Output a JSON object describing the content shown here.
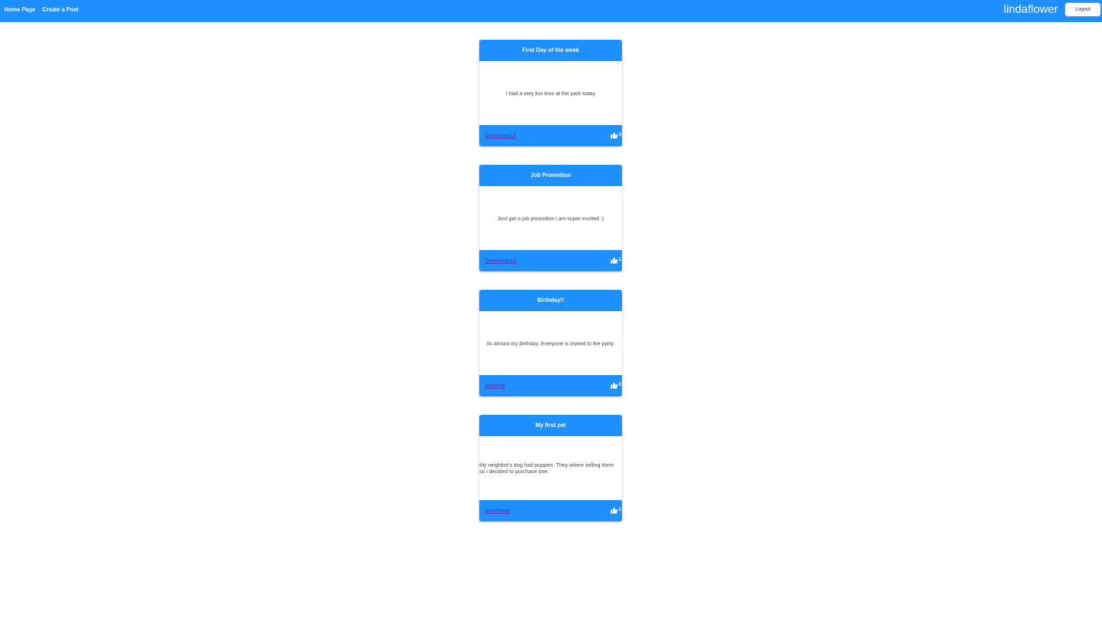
{
  "nav": {
    "home_label": "Home Page",
    "create_label": "Create a Post",
    "username": "lindaflower",
    "logout_label": "Logout"
  },
  "colors": {
    "accent": "#1e90ff",
    "author_link": "#5a2ea6"
  },
  "posts": [
    {
      "title": "First Day of the week",
      "body": "I had a very fun time at the park today",
      "author": "Greenman12",
      "likes": "3",
      "like_icon": "thumbs-up-icon"
    },
    {
      "title": "Job Promotion",
      "body": "Just got a job promotion i am super excited :)",
      "author": "Greenman12",
      "likes": "1",
      "like_icon": "thumbs-up-icon"
    },
    {
      "title": "Birthday!!",
      "body": "Its almost my birthday. Everyone is invited to the party.",
      "author": "tommyG",
      "likes": "0",
      "like_icon": "thumbs-up-icon"
    },
    {
      "title": "My first pet",
      "body": "My neighbor's dog had puppies. They where selling them so i decided to purchase one.",
      "author": "lindaflower",
      "likes": "1",
      "like_icon": "thumbs-up-icon"
    }
  ]
}
